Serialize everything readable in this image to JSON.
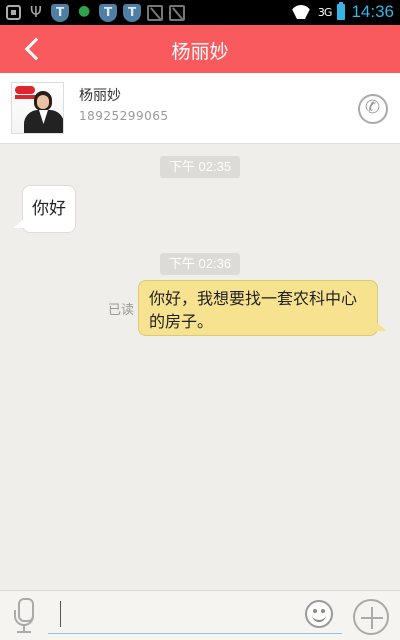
{
  "status_bar": {
    "time": "14:36",
    "signal_text": "3G",
    "left_icons": [
      "notification-icon",
      "usb-icon",
      "shield-icon",
      "security-icon",
      "shield-icon",
      "shield-icon",
      "no-signal-icon",
      "no-signal-icon"
    ]
  },
  "header": {
    "title": "杨丽妙",
    "back_icon": "back-arrow-icon"
  },
  "contact": {
    "name": "杨丽妙",
    "phone": "18925299065",
    "call_icon": "phone-icon"
  },
  "messages": [
    {
      "type": "timestamp",
      "text": "下午 02:35"
    },
    {
      "type": "incoming",
      "text": "你好"
    },
    {
      "type": "timestamp",
      "text": "下午 02:36"
    },
    {
      "type": "outgoing",
      "text": "你好，我想要找一套农科中心的房子。",
      "status": "已读"
    }
  ],
  "input_bar": {
    "value": "",
    "placeholder": "",
    "voice_icon": "microphone-icon",
    "emoji_icon": "emoji-icon",
    "more_icon": "plus-icon"
  },
  "colors": {
    "header_bg": "#f85a5e",
    "outgoing_bubble": "#f7e38f",
    "incoming_bubble": "#ffffff",
    "chat_bg": "#efeeea",
    "time_accent": "#33b5e5"
  }
}
